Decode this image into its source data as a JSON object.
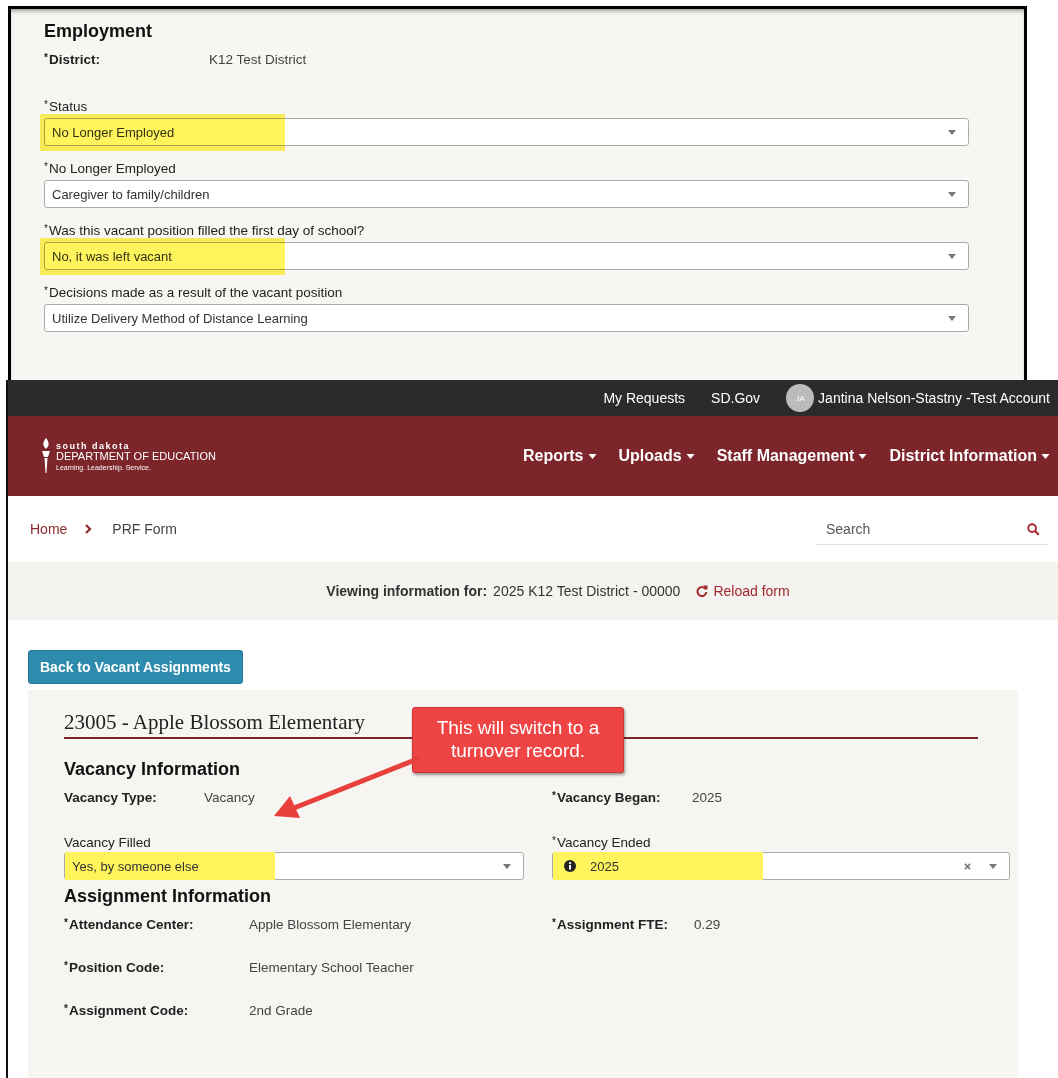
{
  "required_symbol": "*",
  "employment_panel": {
    "heading": "Employment",
    "district": {
      "label": "District:",
      "value": "K12 Test District",
      "required": true
    },
    "fields": [
      {
        "label": "Status",
        "value": "No Longer Employed",
        "required": true,
        "highlighted": true
      },
      {
        "label": "No Longer Employed",
        "value": "Caregiver to family/children",
        "required": true,
        "highlighted": false
      },
      {
        "label": "Was this vacant position filled the first day of school?",
        "value": "No, it was left vacant",
        "required": true,
        "highlighted": true
      },
      {
        "label": "Decisions made as a result of the vacant position",
        "value": "Utilize Delivery Method of Distance Learning",
        "required": true,
        "highlighted": false
      }
    ]
  },
  "top_bar": {
    "links": [
      "My Requests",
      "SD.Gov"
    ],
    "avatar_initials": "JA",
    "user": "Jantina Nelson-Stastny -Test Account"
  },
  "logo": {
    "line_1": "south dakota",
    "line_2": "DEPARTMENT OF EDUCATION",
    "tagline": "Learning. Leadership. Service."
  },
  "nav": [
    "Reports",
    "Uploads",
    "Staff Management",
    "District Information"
  ],
  "breadcrumb": [
    "Home",
    "PRF Form"
  ],
  "search": {
    "placeholder": "Search"
  },
  "viewing_bar": {
    "label": "Viewing information for:",
    "value": "2025 K12 Test District - 00000",
    "action": "Reload form"
  },
  "back_button": "Back to Vacant Assignments",
  "record": {
    "title": "23005 - Apple Blossom Elementary",
    "vacancy_heading": "Vacancy Information",
    "vacancy_pairs": [
      {
        "label": "Vacancy Type:",
        "value": "Vacancy",
        "required": false
      },
      {
        "label": "Vacancy Began:",
        "value": "2025",
        "required": true
      }
    ],
    "vacancy_fields": [
      {
        "label": "Vacancy Filled",
        "value": "Yes, by someone else",
        "required": false,
        "highlighted": true,
        "info": false,
        "clearable": false
      },
      {
        "label": "Vacancy Ended",
        "value": "2025",
        "required": true,
        "highlighted": true,
        "info": true,
        "clearable": true
      }
    ],
    "assignment_heading": "Assignment Information",
    "assignment_rows": [
      [
        {
          "label": "Attendance Center:",
          "value": "Apple Blossom Elementary",
          "required": true
        },
        {
          "label": "Assignment FTE:",
          "value": "0.29",
          "required": true
        }
      ],
      [
        {
          "label": "Position Code:",
          "value": "Elementary School Teacher",
          "required": true
        }
      ],
      [
        {
          "label": "Assignment Code:",
          "value": "2nd Grade",
          "required": true
        }
      ]
    ]
  },
  "callout": {
    "text": "This will switch to a turnover record."
  }
}
